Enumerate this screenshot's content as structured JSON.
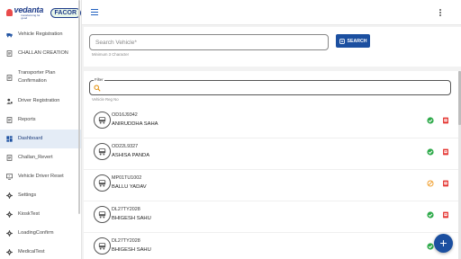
{
  "brand": {
    "name": "vedanta",
    "tagline": "transforming for good",
    "partner": "FACOR"
  },
  "sidebar": {
    "items": [
      {
        "label": "Vehicle Registration",
        "icon": "truck-icon",
        "active": false
      },
      {
        "label": "CHALLAN CREATION",
        "icon": "document-icon",
        "active": false
      },
      {
        "label": "Transporter Plan Confirmation",
        "icon": "document-icon",
        "active": false
      },
      {
        "label": "Driver Registration",
        "icon": "person-icon",
        "active": false
      },
      {
        "label": "Reports",
        "icon": "document-icon",
        "active": false
      },
      {
        "label": "Dashboard",
        "icon": "dashboard-icon",
        "active": true
      },
      {
        "label": "Challan_Revert",
        "icon": "document-icon",
        "active": false
      },
      {
        "label": "Vehicle Driver Reset",
        "icon": "monitor-icon",
        "active": false
      },
      {
        "label": "Settings",
        "icon": "gear-icon",
        "active": false
      },
      {
        "label": "KioskTest",
        "icon": "gear-icon",
        "active": false
      },
      {
        "label": "LoadingConfirm",
        "icon": "gear-icon",
        "active": false
      },
      {
        "label": "MedicalTest",
        "icon": "gear-icon",
        "active": false
      }
    ]
  },
  "search": {
    "placeholder": "Search Vehicle*",
    "hint": "Minimum 3 Character",
    "button_label": "SEARCH"
  },
  "filter": {
    "label": "Filter",
    "hint": "Vehicle Reg No"
  },
  "vehicles": [
    {
      "reg_no": "OD16J9342",
      "driver": "ANIRUDDHA SAHA",
      "status": "approved",
      "status_color": "#2eaa4a"
    },
    {
      "reg_no": "OD22L9327",
      "driver": "ASHISA PANDA",
      "status": "approved",
      "status_color": "#2eaa4a"
    },
    {
      "reg_no": "MP01TU1002",
      "driver": "BALLU YADAV",
      "status": "blocked",
      "status_color": "#f0a030"
    },
    {
      "reg_no": "DL27TY2028",
      "driver": "BHIGESH SAHU",
      "status": "approved",
      "status_color": "#2eaa4a"
    },
    {
      "reg_no": "DL27TY2028",
      "driver": "BHIGESH SAHU",
      "status": "approved",
      "status_color": "#2eaa4a"
    }
  ],
  "colors": {
    "primary": "#1b4fa0",
    "doc_icon": "#e53935",
    "active_nav_bg": "#e4ecf6"
  },
  "fab": {
    "label": "+"
  }
}
